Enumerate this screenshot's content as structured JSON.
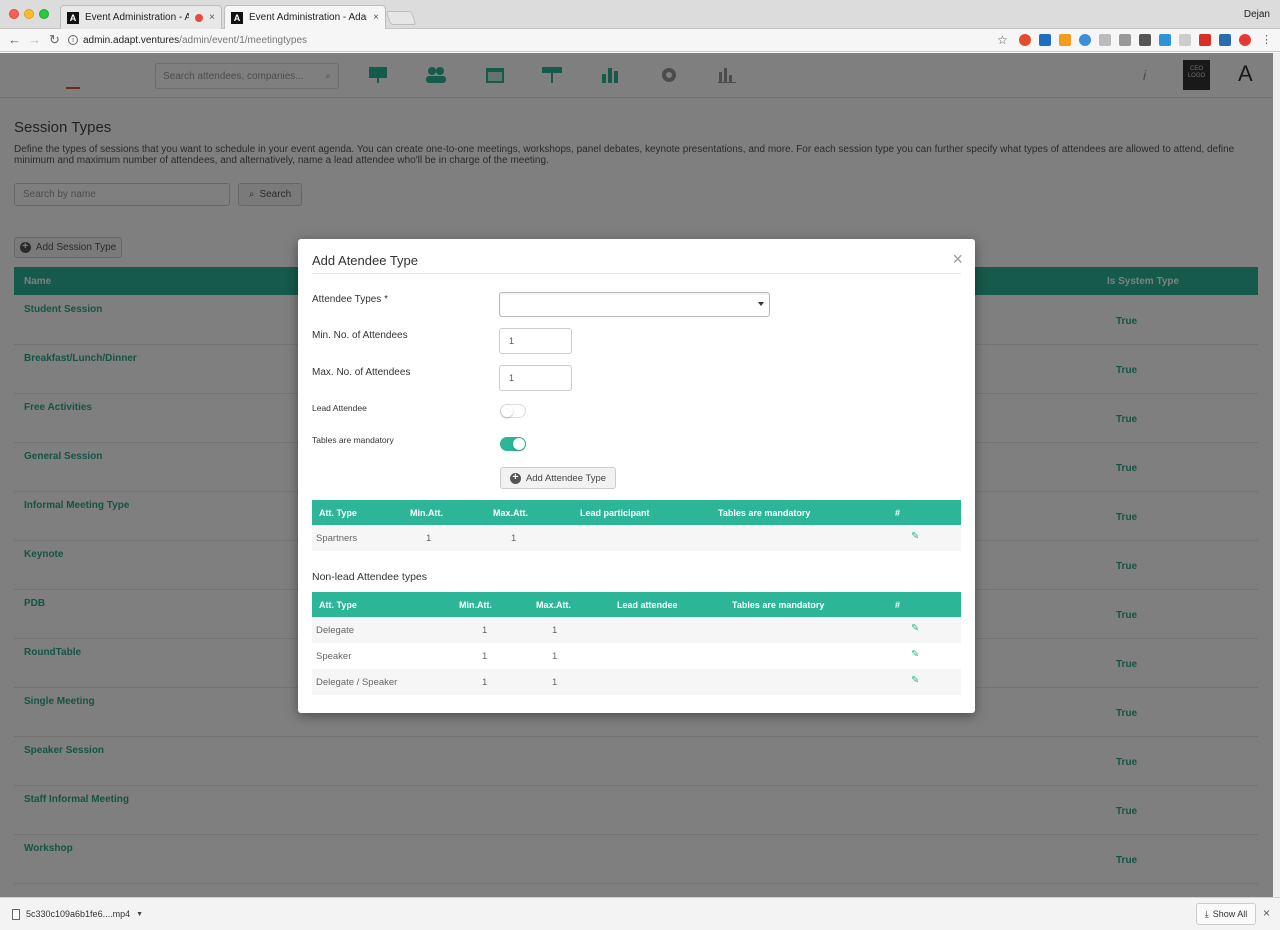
{
  "browser": {
    "tabs": [
      {
        "title": "Event Administration - Adapt",
        "recording": true,
        "close": "×"
      },
      {
        "title": "Event Administration - Adapt",
        "recording": false,
        "close": "×"
      }
    ],
    "tab_favicon": "A",
    "profile_name": "Dejan",
    "url_host": "admin.adapt.ventures",
    "url_path": "/admin/event/1/meetingtypes"
  },
  "app": {
    "search_placeholder": "Search attendees, companies...",
    "nav_icons": [
      "presentation-icon",
      "people-icon",
      "calendar-icon",
      "signpost-icon",
      "bar-chart-icon",
      "gear-icon",
      "stats-icon"
    ],
    "event_logo_text": "CEO LOGO",
    "brand_letter": "A",
    "info_glyph": "i"
  },
  "page": {
    "title": "Session Types",
    "description": "Define the types of sessions that you want to schedule in your event agenda. You can create one-to-one meetings, workshops, panel debates, keynote presentations, and more. For each session type you can further specify what types of attendees are allowed to attend, define minimum and maximum number of attendees, and alternatively, name a lead attendee who'll be in charge of the meeting.",
    "search_placeholder": "Search by name",
    "search_button": "Search",
    "add_button": "Add Session Type",
    "list_headers": {
      "name": "Name",
      "system": "Is System Type"
    },
    "rows": [
      {
        "name": "Student Session",
        "value": "True"
      },
      {
        "name": "Breakfast/Lunch/Dinner",
        "value": "True"
      },
      {
        "name": "Free Activities",
        "value": "True"
      },
      {
        "name": "General Session",
        "value": "True"
      },
      {
        "name": "Informal Meeting Type",
        "value": "True"
      },
      {
        "name": "Keynote",
        "value": "True"
      },
      {
        "name": "PDB",
        "value": "True"
      },
      {
        "name": "RoundTable",
        "value": "True"
      },
      {
        "name": "Single Meeting",
        "value": "True"
      },
      {
        "name": "Speaker Session",
        "value": "True"
      },
      {
        "name": "Staff Informal Meeting",
        "value": "True"
      },
      {
        "name": "Workshop",
        "value": "True"
      }
    ]
  },
  "modal": {
    "title": "Add Atendee Type",
    "close_glyph": "×",
    "labels": {
      "attendee_types": "Attendee Types *",
      "min": "Min. No. of Attendees",
      "max": "Max. No. of Attendees",
      "lead": "Lead Attendee",
      "tables": "Tables are mandatory"
    },
    "min_value": "1",
    "max_value": "1",
    "lead_on": false,
    "tables_on": true,
    "add_button": "Add Attendee Type",
    "lead_table": {
      "headers": [
        "Att. Type",
        "Min.Att.",
        "Max.Att.",
        "Lead participant",
        "Tables are mandatory",
        "#"
      ],
      "rows": [
        {
          "type": "Spartners",
          "min": "1",
          "max": "1"
        }
      ]
    },
    "nonlead_label": "Non-lead Attendee types",
    "nonlead_table": {
      "headers": [
        "Att. Type",
        "Min.Att.",
        "Max.Att.",
        "Lead attendee",
        "Tables are mandatory",
        "#"
      ],
      "rows": [
        {
          "type": "Delegate",
          "min": "1",
          "max": "1"
        },
        {
          "type": "Speaker",
          "min": "1",
          "max": "1"
        },
        {
          "type": "Delegate / Speaker",
          "min": "1",
          "max": "1"
        }
      ]
    }
  },
  "downloads": {
    "file_name": "5c330c109a6b1fe6....mp4",
    "show_all": "Show All"
  }
}
